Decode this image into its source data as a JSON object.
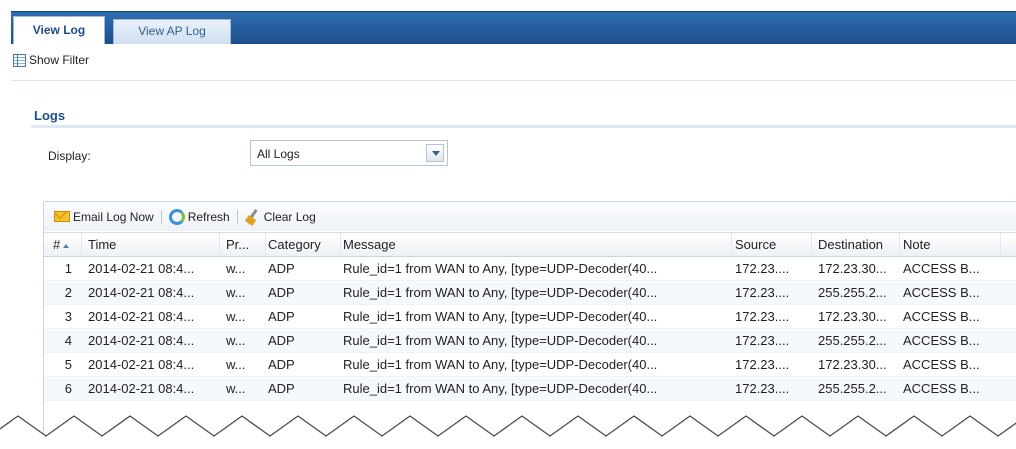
{
  "tabs": [
    {
      "label": "View Log",
      "active": true
    },
    {
      "label": "View AP Log",
      "active": false
    }
  ],
  "filter": {
    "show_filter_label": "Show Filter"
  },
  "section": {
    "title": "Logs"
  },
  "display": {
    "label": "Display:",
    "selected": "All Logs"
  },
  "toolbar": {
    "email_label": "Email Log Now",
    "refresh_label": "Refresh",
    "clear_label": "Clear Log"
  },
  "table": {
    "columns": [
      "#",
      "Time",
      "Pr...",
      "Category",
      "Message",
      "Source",
      "Destination",
      "Note"
    ],
    "rows": [
      {
        "num": "1",
        "time": "2014-02-21 08:4...",
        "priority": "w...",
        "category": "ADP",
        "message": "Rule_id=1 from WAN to Any, [type=UDP-Decoder(40...",
        "source": "172.23....",
        "destination": "172.23.30...",
        "note": "ACCESS B..."
      },
      {
        "num": "2",
        "time": "2014-02-21 08:4...",
        "priority": "w...",
        "category": "ADP",
        "message": "Rule_id=1 from WAN to Any, [type=UDP-Decoder(40...",
        "source": "172.23....",
        "destination": "255.255.2...",
        "note": "ACCESS B..."
      },
      {
        "num": "3",
        "time": "2014-02-21 08:4...",
        "priority": "w...",
        "category": "ADP",
        "message": "Rule_id=1 from WAN to Any, [type=UDP-Decoder(40...",
        "source": "172.23....",
        "destination": "172.23.30...",
        "note": "ACCESS B..."
      },
      {
        "num": "4",
        "time": "2014-02-21 08:4...",
        "priority": "w...",
        "category": "ADP",
        "message": "Rule_id=1 from WAN to Any, [type=UDP-Decoder(40...",
        "source": "172.23....",
        "destination": "255.255.2...",
        "note": "ACCESS B..."
      },
      {
        "num": "5",
        "time": "2014-02-21 08:4...",
        "priority": "w...",
        "category": "ADP",
        "message": "Rule_id=1 from WAN to Any, [type=UDP-Decoder(40...",
        "source": "172.23....",
        "destination": "172.23.30...",
        "note": "ACCESS B..."
      },
      {
        "num": "6",
        "time": "2014-02-21 08:4...",
        "priority": "w...",
        "category": "ADP",
        "message": "Rule_id=1 from WAN to Any, [type=UDP-Decoder(40...",
        "source": "172.23....",
        "destination": "255.255.2...",
        "note": "ACCESS B..."
      }
    ]
  }
}
